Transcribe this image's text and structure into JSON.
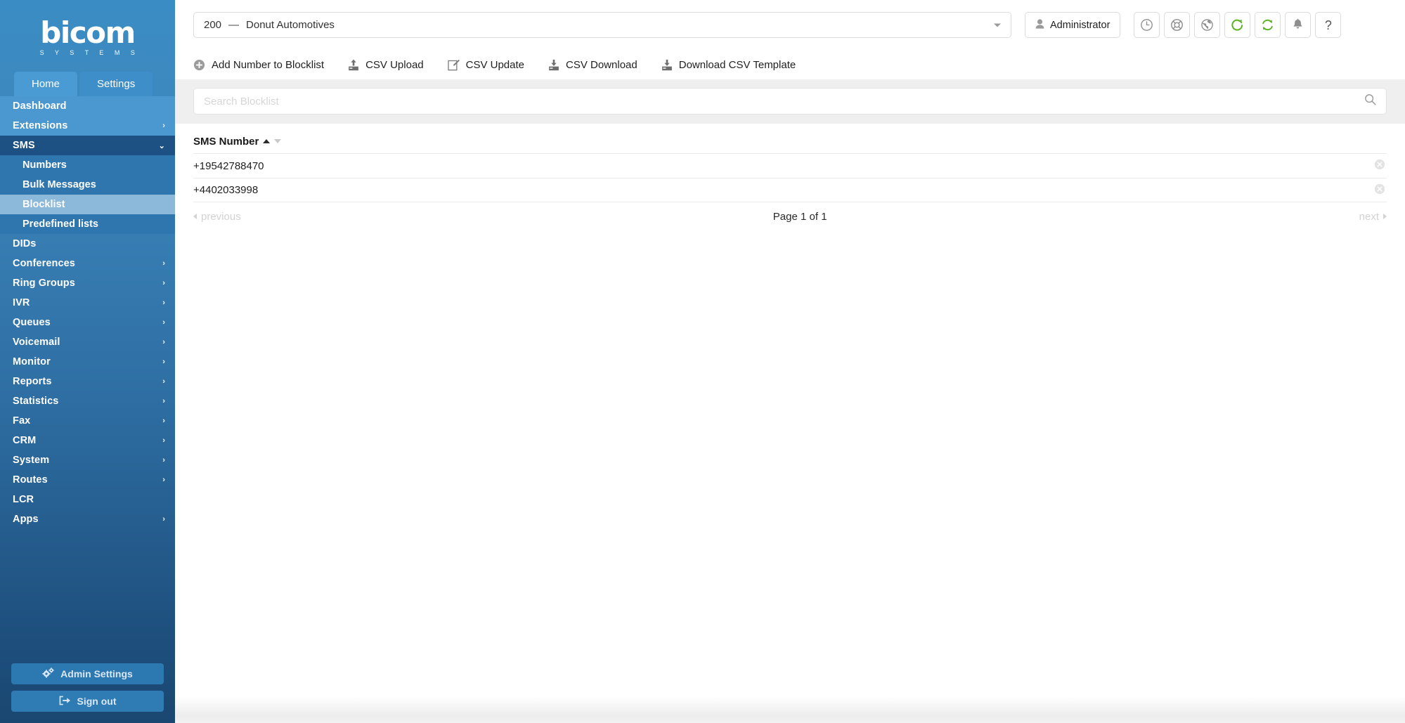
{
  "brand": {
    "name": "bicom",
    "tagline": "S Y S T E M S"
  },
  "sidebar": {
    "tabs": [
      {
        "label": "Home",
        "active": true
      },
      {
        "label": "Settings",
        "active": false
      }
    ],
    "items": [
      {
        "label": "Dashboard",
        "arrow": "",
        "state": "top"
      },
      {
        "label": "Extensions",
        "arrow": "›",
        "state": "top"
      },
      {
        "label": "SMS",
        "arrow": "⌄",
        "state": "expanded"
      },
      {
        "label": "Numbers",
        "arrow": "",
        "state": "sub"
      },
      {
        "label": "Bulk Messages",
        "arrow": "",
        "state": "sub"
      },
      {
        "label": "Blocklist",
        "arrow": "",
        "state": "sub-selected"
      },
      {
        "label": "Predefined lists",
        "arrow": "",
        "state": "sub"
      },
      {
        "label": "DIDs",
        "arrow": "",
        "state": "normal"
      },
      {
        "label": "Conferences",
        "arrow": "›",
        "state": "normal"
      },
      {
        "label": "Ring Groups",
        "arrow": "›",
        "state": "normal"
      },
      {
        "label": "IVR",
        "arrow": "›",
        "state": "normal"
      },
      {
        "label": "Queues",
        "arrow": "›",
        "state": "normal"
      },
      {
        "label": "Voicemail",
        "arrow": "›",
        "state": "normal"
      },
      {
        "label": "Monitor",
        "arrow": "›",
        "state": "normal"
      },
      {
        "label": "Reports",
        "arrow": "›",
        "state": "normal"
      },
      {
        "label": "Statistics",
        "arrow": "›",
        "state": "normal"
      },
      {
        "label": "Fax",
        "arrow": "›",
        "state": "normal"
      },
      {
        "label": "CRM",
        "arrow": "›",
        "state": "normal"
      },
      {
        "label": "System",
        "arrow": "›",
        "state": "normal"
      },
      {
        "label": "Routes",
        "arrow": "›",
        "state": "normal"
      },
      {
        "label": "LCR",
        "arrow": "",
        "state": "normal"
      },
      {
        "label": "Apps",
        "arrow": "›",
        "state": "normal"
      }
    ],
    "admin_settings_label": "Admin Settings",
    "sign_out_label": "Sign out"
  },
  "header": {
    "context": {
      "number": "200",
      "dash": "—",
      "name": "Donut Automotives"
    },
    "user_label": "Administrator",
    "icon_buttons": [
      {
        "name": "clock-icon"
      },
      {
        "name": "lifebuoy-icon"
      },
      {
        "name": "globe-icon"
      },
      {
        "name": "reload-icon"
      },
      {
        "name": "sync-icon"
      },
      {
        "name": "bell-icon"
      },
      {
        "name": "help-icon"
      }
    ]
  },
  "toolbar": [
    {
      "label": "Add Number to Blocklist",
      "icon": "plus-circle-icon"
    },
    {
      "label": "CSV Upload",
      "icon": "upload-icon"
    },
    {
      "label": "CSV Update",
      "icon": "edit-icon"
    },
    {
      "label": "CSV Download",
      "icon": "download-icon"
    },
    {
      "label": "Download CSV Template",
      "icon": "download-icon"
    }
  ],
  "search": {
    "placeholder": "Search Blocklist",
    "value": ""
  },
  "table": {
    "columns": [
      {
        "label": "SMS Number",
        "sort": "asc"
      }
    ],
    "rows": [
      {
        "sms_number": "+19542788470"
      },
      {
        "sms_number": "+4402033998"
      }
    ]
  },
  "pagination": {
    "previous": "previous",
    "page_info": "Page 1 of 1",
    "next": "next"
  },
  "colors": {
    "sidebar_top": "#3a8dc4",
    "sidebar_bottom": "#1a4771",
    "selected_row": "#8cb8d9",
    "expanded": "#1d5183",
    "accent_green": "#5cb226",
    "searchbar_bg": "#efefef"
  }
}
